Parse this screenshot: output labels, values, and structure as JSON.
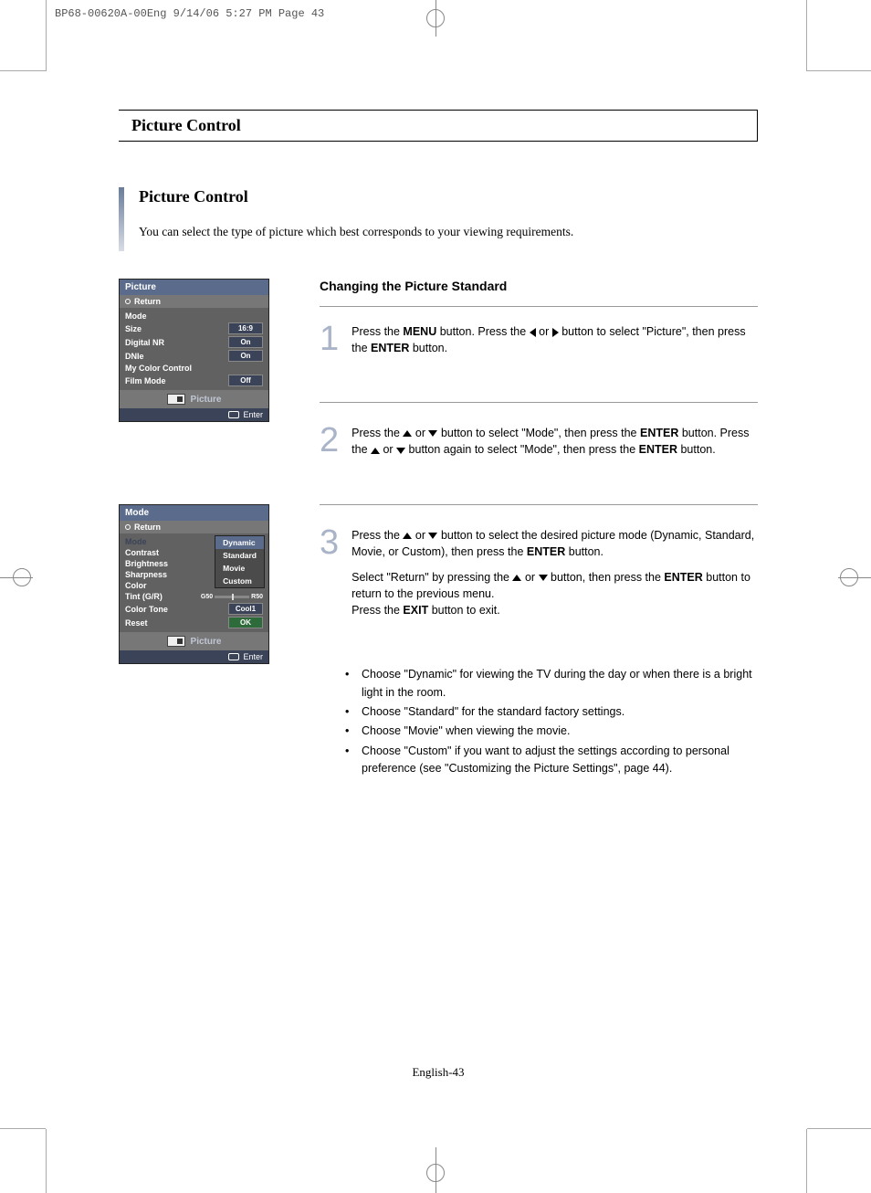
{
  "crop_header": "BP68-00620A-00Eng  9/14/06  5:27 PM  Page 43",
  "title_main": "Picture Control",
  "section_title": "Picture Control",
  "intro": "You can select the type of picture which best corresponds to your viewing requirements.",
  "heading": "Changing the Picture Standard",
  "steps": {
    "s1": {
      "num": "1",
      "a": "Press the ",
      "b": " button. Press the ",
      "c": " or ",
      "d": " button to select \"Picture\", then press the ",
      "e": " button.",
      "menu": "MENU",
      "enter": "ENTER"
    },
    "s2": {
      "num": "2",
      "a": "Press the ",
      "b": " or ",
      "c": " button to select \"Mode\", then press the ",
      "d": " button. Press the ",
      "e": " or ",
      "f": " button again to select \"Mode\", then press the ",
      "g": " button.",
      "enter": "ENTER"
    },
    "s3": {
      "num": "3",
      "p1a": "Press the ",
      "p1b": " or ",
      "p1c": " button to select the desired picture mode (Dynamic, Standard, Movie, or Custom), then press the ",
      "p1d": " button.",
      "p2a": "Select \"Return\" by pressing the ",
      "p2b": " or ",
      "p2c": " button, then press the ",
      "p2d": " button to return to the previous menu.",
      "p3a": "Press the ",
      "p3b": " button to exit.",
      "enter": "ENTER",
      "exit": "EXIT"
    }
  },
  "bullets": [
    "Choose \"Dynamic\" for viewing the TV during the day or when there is a bright light in the room.",
    "Choose \"Standard\" for the standard factory settings.",
    "Choose \"Movie\" when viewing the movie.",
    "Choose \"Custom\" if you want to adjust the settings according to personal preference (see \"Customizing the Picture Settings\", page 44)."
  ],
  "pagenum": "English-43",
  "osd1": {
    "title": "Picture",
    "return": "Return",
    "rows": [
      {
        "label": "Mode",
        "value": ""
      },
      {
        "label": "Size",
        "value": "16:9"
      },
      {
        "label": "Digital NR",
        "value": "On"
      },
      {
        "label": "DNIe",
        "value": "On"
      },
      {
        "label": "My Color Control",
        "value": ""
      },
      {
        "label": "Film Mode",
        "value": "Off"
      }
    ],
    "footer_label": "Picture",
    "enter": "Enter"
  },
  "osd2": {
    "title": "Mode",
    "return": "Return",
    "left_items": [
      "Mode",
      "Contrast",
      "Brightness",
      "Sharpness",
      "Color",
      "Tint (G/R)",
      "Color Tone",
      "Reset"
    ],
    "options": [
      "Dynamic",
      "Standard",
      "Movie",
      "Custom"
    ],
    "slider_l": "G50",
    "slider_r": "R50",
    "cool": "Cool1",
    "ok": "OK",
    "footer_label": "Picture",
    "enter": "Enter"
  }
}
